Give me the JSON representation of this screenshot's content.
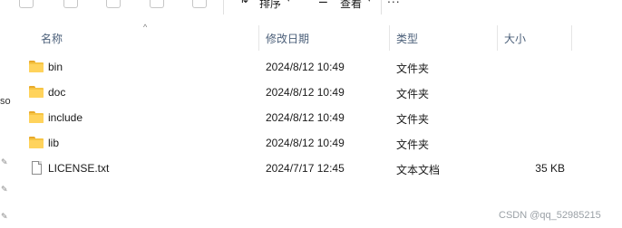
{
  "toolbar": {
    "sort_label": "排序",
    "view_label": "查看",
    "more_label": "..."
  },
  "nav": {
    "partial_text": "so"
  },
  "columns": {
    "name": "名称",
    "date": "修改日期",
    "type": "类型",
    "size": "大小"
  },
  "files": [
    {
      "name": "bin",
      "date": "2024/8/12 10:49",
      "type": "文件夹",
      "size": "",
      "icon": "folder-icon"
    },
    {
      "name": "doc",
      "date": "2024/8/12 10:49",
      "type": "文件夹",
      "size": "",
      "icon": "folder-icon"
    },
    {
      "name": "include",
      "date": "2024/8/12 10:49",
      "type": "文件夹",
      "size": "",
      "icon": "folder-icon"
    },
    {
      "name": "lib",
      "date": "2024/8/12 10:49",
      "type": "文件夹",
      "size": "",
      "icon": "folder-icon"
    },
    {
      "name": "LICENSE.txt",
      "date": "2024/7/17 12:45",
      "type": "文本文档",
      "size": "35 KB",
      "icon": "text-file-icon"
    }
  ],
  "watermark": "CSDN @qq_52985215"
}
